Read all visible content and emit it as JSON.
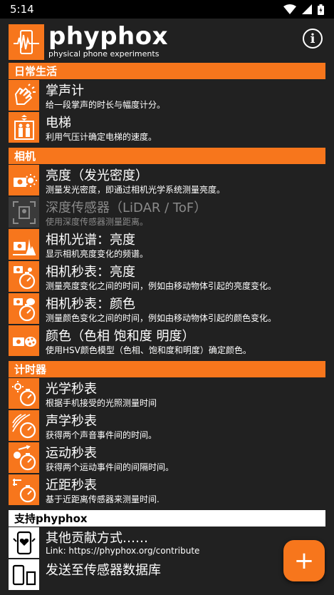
{
  "status": {
    "time": "5:14"
  },
  "header": {
    "brand": "phyphox",
    "tagline": "physical phone experiments"
  },
  "sections": [
    {
      "title": "日常生活",
      "items": [
        {
          "title": "掌声计",
          "desc": "给一段掌声的时长与幅度计分。",
          "icon": "clapping-hands-icon"
        },
        {
          "title": "电梯",
          "desc": "利用气压计确定电梯的速度。",
          "icon": "elevator-icon"
        }
      ]
    },
    {
      "title": "相机",
      "items": [
        {
          "title": "亮度（发光密度）",
          "desc": "测量发光密度，即通过相机光学系统测量亮度。",
          "icon": "camera-sun-icon"
        },
        {
          "title": "深度传感器（LiDAR / ToF）",
          "desc": "使用深度传感器测量距离。",
          "icon": "depth-sensor-icon",
          "disabled": true
        },
        {
          "title": "相机光谱：亮度",
          "desc": "显示相机亮度变化的频谱。",
          "icon": "camera-spectrum-icon"
        },
        {
          "title": "相机秒表：亮度",
          "desc": "测量亮度变化之间的时间，例如由移动物体引起的亮度变化。",
          "icon": "camera-stopwatch-icon"
        },
        {
          "title": "相机秒表：颜色",
          "desc": "测量颜色变化之间的时间，例如由移动物体引起的颜色变化。",
          "icon": "camera-palette-stopwatch-icon"
        },
        {
          "title": "颜色（色相 饱和度 明度）",
          "desc": "使用HSV颜色模型（色相、饱和度和明度）确定颜色。",
          "icon": "camera-palette-icon"
        }
      ]
    },
    {
      "title": "计时器",
      "items": [
        {
          "title": "光学秒表",
          "desc": "根据手机接受的光照测量时间",
          "icon": "light-stopwatch-icon"
        },
        {
          "title": "声学秒表",
          "desc": "获得两个声音事件间的时间。",
          "icon": "sound-stopwatch-icon"
        },
        {
          "title": "运动秒表",
          "desc": "获得两个运动事件间的间隔时间。",
          "icon": "motion-stopwatch-icon"
        },
        {
          "title": "近距秒表",
          "desc": "基于近距离传感器来测量时间.",
          "icon": "proximity-stopwatch-icon"
        }
      ]
    },
    {
      "title": "支持phyphox",
      "items": [
        {
          "title": "其他贡献方式……",
          "desc": "Link: https://phyphox.org/contribute",
          "icon": "phone-heart-icon"
        },
        {
          "title": "发送至传感器数据库",
          "desc": "",
          "icon": "phone-database-icon"
        }
      ]
    }
  ],
  "fab": {
    "label": "+"
  },
  "colors": {
    "accent": "#f7761c",
    "background": "#212121"
  }
}
